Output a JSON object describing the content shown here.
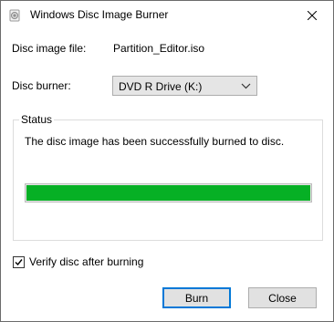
{
  "window": {
    "title": "Windows Disc Image Burner"
  },
  "fields": {
    "disc_image_label": "Disc image file:",
    "disc_image_value": "Partition_Editor.iso",
    "disc_burner_label": "Disc burner:",
    "disc_burner_selected": "DVD R Drive (K:)"
  },
  "status": {
    "group_label": "Status",
    "message": "The disc image has been successfully burned to disc.",
    "progress_percent": 100,
    "progress_color": "#06b025"
  },
  "options": {
    "verify_label": "Verify disc after burning",
    "verify_checked": true
  },
  "buttons": {
    "burn_label": "Burn",
    "close_label": "Close"
  },
  "icons": [
    "disc-burner-app-icon",
    "close-icon",
    "chevron-down-icon",
    "checkmark-icon"
  ]
}
